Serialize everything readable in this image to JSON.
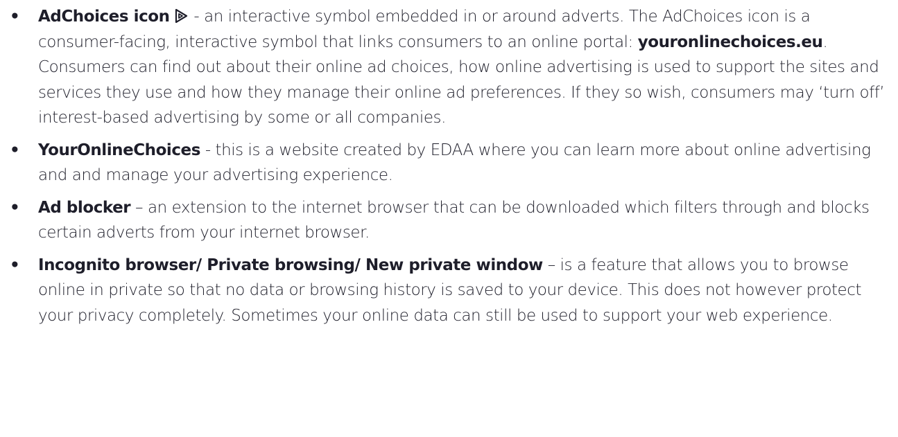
{
  "items": [
    {
      "term": "AdChoices icon",
      "icon": "adchoices-icon",
      "text1": " - an interactive symbol embedded in or around adverts. The AdChoices icon is a consumer-facing, interactive symbol that links consumers to an online portal: ",
      "link": "youronlinechoices.eu",
      "text2": ". Consumers can find out about their online ad choices, how online advertising is used to support the sites and services they use and how they manage their online ad preferences. If they so wish, consumers may ‘turn off’ interest-based advertising by some or all companies."
    },
    {
      "term": "YourOnlineChoices",
      "text": " - this is a website created by EDAA where you can learn more about online advertising and and manage your advertising experience."
    },
    {
      "term": "Ad blocker",
      "text": " – an extension to the internet browser that can be downloaded which filters through and blocks certain adverts from your internet browser."
    },
    {
      "term": "Incognito browser/ Private browsing/ New private window",
      "text": " – is a feature that allows you to browse online in private so that no data or browsing history is saved to your device. This does not however protect your privacy completely. Sometimes your online data can still be used to support your web experience."
    }
  ]
}
